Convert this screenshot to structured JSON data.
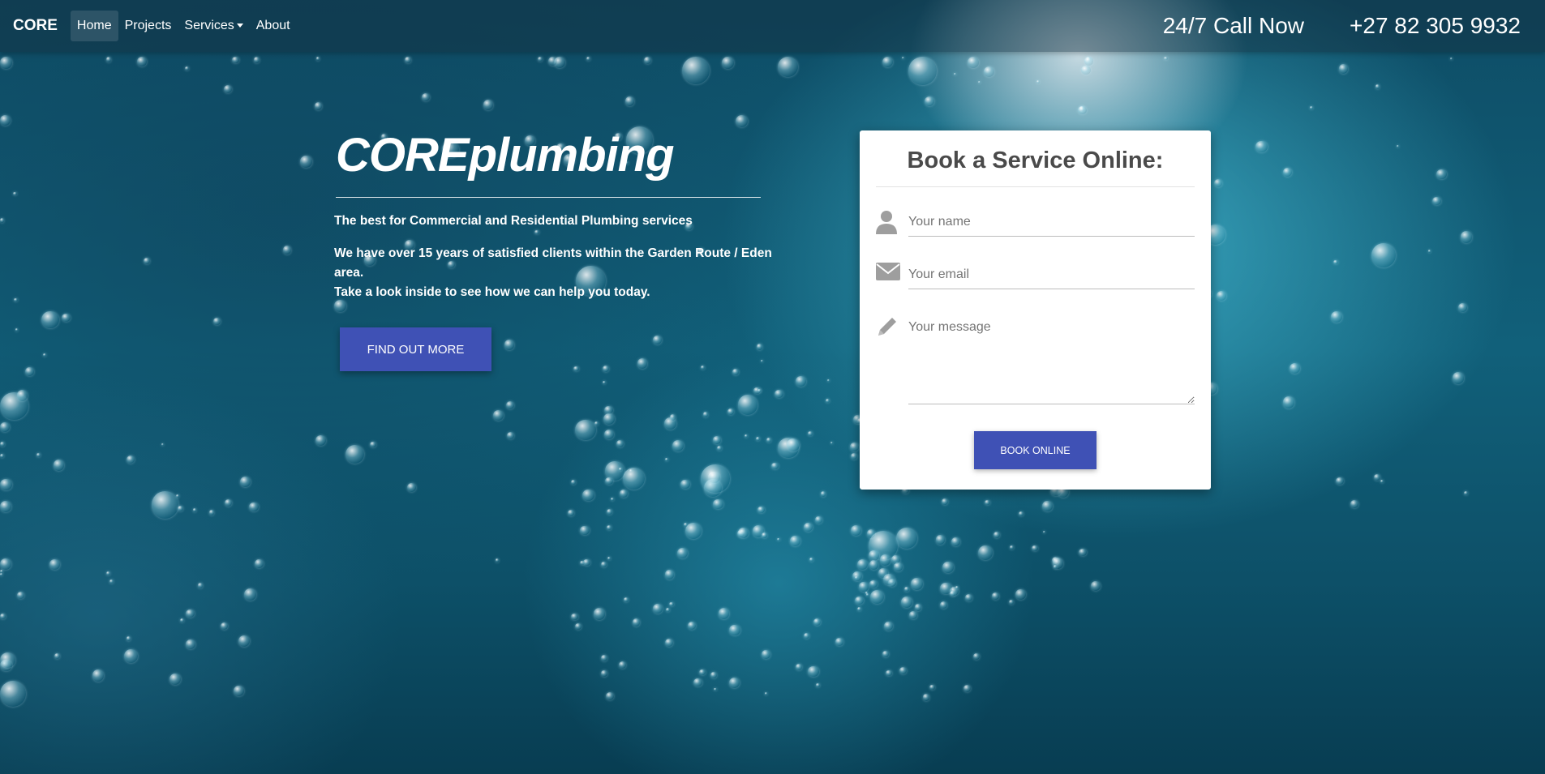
{
  "navbar": {
    "brand": "CORE",
    "items": [
      {
        "label": "Home"
      },
      {
        "label": "Projects"
      },
      {
        "label": "Services"
      },
      {
        "label": "About"
      }
    ],
    "call_label": "24/7 Call Now",
    "phone": "+27 82 305 9932"
  },
  "hero": {
    "title": "COREplumbing",
    "tagline": "The best for Commercial and Residential Plumbing services",
    "line1": "We have over 15 years of satisfied clients within the Garden Route / Eden area.",
    "line2": "Take a look inside to see how we can help you today.",
    "cta_label": "FIND OUT MORE"
  },
  "form": {
    "title": "Book a Service Online:",
    "name_placeholder": "Your name",
    "email_placeholder": "Your email",
    "message_placeholder": "Your message",
    "submit_label": "BOOK ONLINE"
  },
  "colors": {
    "accent": "#3f51b5",
    "background": "#0e4d66"
  },
  "icons": [
    "person-icon",
    "envelope-icon",
    "pencil-icon",
    "caret-down-icon"
  ]
}
